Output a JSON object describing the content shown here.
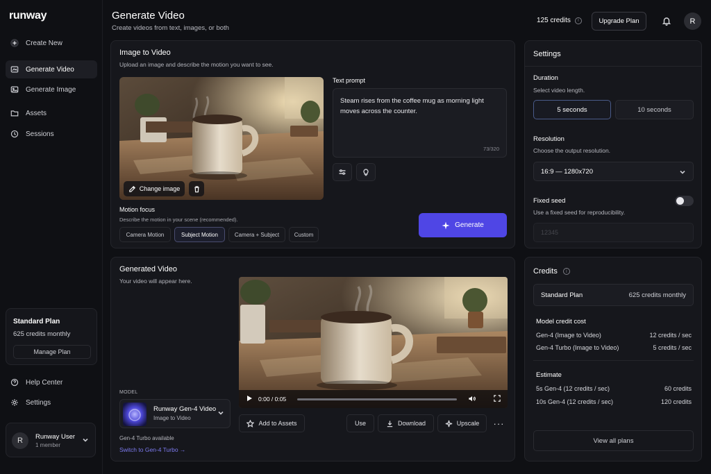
{
  "brand": {
    "logo": "runway"
  },
  "sidebar": {
    "items": [
      {
        "label": "Create New",
        "icon": "plus-icon"
      },
      {
        "label": "Generate Video",
        "icon": "video-icon",
        "active": true
      },
      {
        "label": "Generate Image",
        "icon": "image-icon"
      },
      {
        "label": "Assets",
        "icon": "folder-icon"
      },
      {
        "label": "Sessions",
        "icon": "history-icon"
      }
    ],
    "plan": {
      "title": "Standard Plan",
      "credits": "625 credits monthly",
      "manage_label": "Manage Plan"
    },
    "footer": [
      {
        "label": "Help Center",
        "icon": "help-icon"
      },
      {
        "label": "Settings",
        "icon": "gear-icon"
      }
    ],
    "user": {
      "initial": "R",
      "name": "Runway User",
      "sub": "1 member"
    }
  },
  "header": {
    "title": "Generate Video",
    "subtitle": "Create videos from text, images, or both",
    "credits": "125 credits",
    "upgrade_label": "Upgrade Plan",
    "avatar_initial": "R"
  },
  "image_to_video": {
    "title": "Image to Video",
    "subtitle": "Upload an image and describe the motion you want to see.",
    "change_image_label": "Change image",
    "prompt_label": "Text prompt",
    "prompt_text": "Steam rises from the coffee mug as morning light moves across the counter.",
    "prompt_count": "73/320",
    "motion_focus_label": "Motion focus",
    "motion_focus_sub": "Describe the motion in your scene (recommended).",
    "chips": [
      {
        "label": "Camera Motion",
        "active": false
      },
      {
        "label": "Subject Motion",
        "active": true
      },
      {
        "label": "Camera + Subject",
        "active": false
      },
      {
        "label": "Custom",
        "active": false
      }
    ],
    "generate_label": "Generate"
  },
  "generated": {
    "title": "Generated Video",
    "subtitle": "Your video will appear here.",
    "time": "0:00 / 0:05",
    "progress": 0,
    "model_label": "MODEL",
    "model_name": "Runway Gen-4 Video",
    "model_sub": "Image to Video",
    "turbo_available": "Gen-4 Turbo available",
    "turbo_link": "Switch to Gen-4 Turbo →",
    "actions": {
      "add_assets": "Add to Assets",
      "use": "Use",
      "download": "Download",
      "upscale": "Upscale"
    }
  },
  "settings": {
    "title": "Settings",
    "duration_label": "Duration",
    "duration_sub": "Select video length.",
    "durations": [
      {
        "label": "5 seconds",
        "active": true
      },
      {
        "label": "10 seconds",
        "active": false
      }
    ],
    "resolution_label": "Resolution",
    "resolution_sub": "Choose the output resolution.",
    "resolution_value": "16:9 — 1280x720",
    "seed_label": "Fixed seed",
    "seed_sub": "Use a fixed seed for reproducibility.",
    "seed_enabled": false,
    "seed_placeholder": "12345"
  },
  "credits_panel": {
    "title": "Credits",
    "plan_name": "Standard Plan",
    "plan_credits": "625 credits monthly",
    "model_cost_label": "Model credit cost",
    "model_costs": [
      {
        "name": "Gen-4 (Image to Video)",
        "value": "12 credits / sec"
      },
      {
        "name": "Gen-4 Turbo (Image to Video)",
        "value": "5 credits / sec"
      }
    ],
    "estimate_label": "Estimate",
    "estimates": [
      {
        "name": "5s Gen-4 (12 credits / sec)",
        "value": "60 credits"
      },
      {
        "name": "10s Gen-4 (12 credits / sec)",
        "value": "120 credits"
      }
    ],
    "view_all_label": "View all plans"
  }
}
